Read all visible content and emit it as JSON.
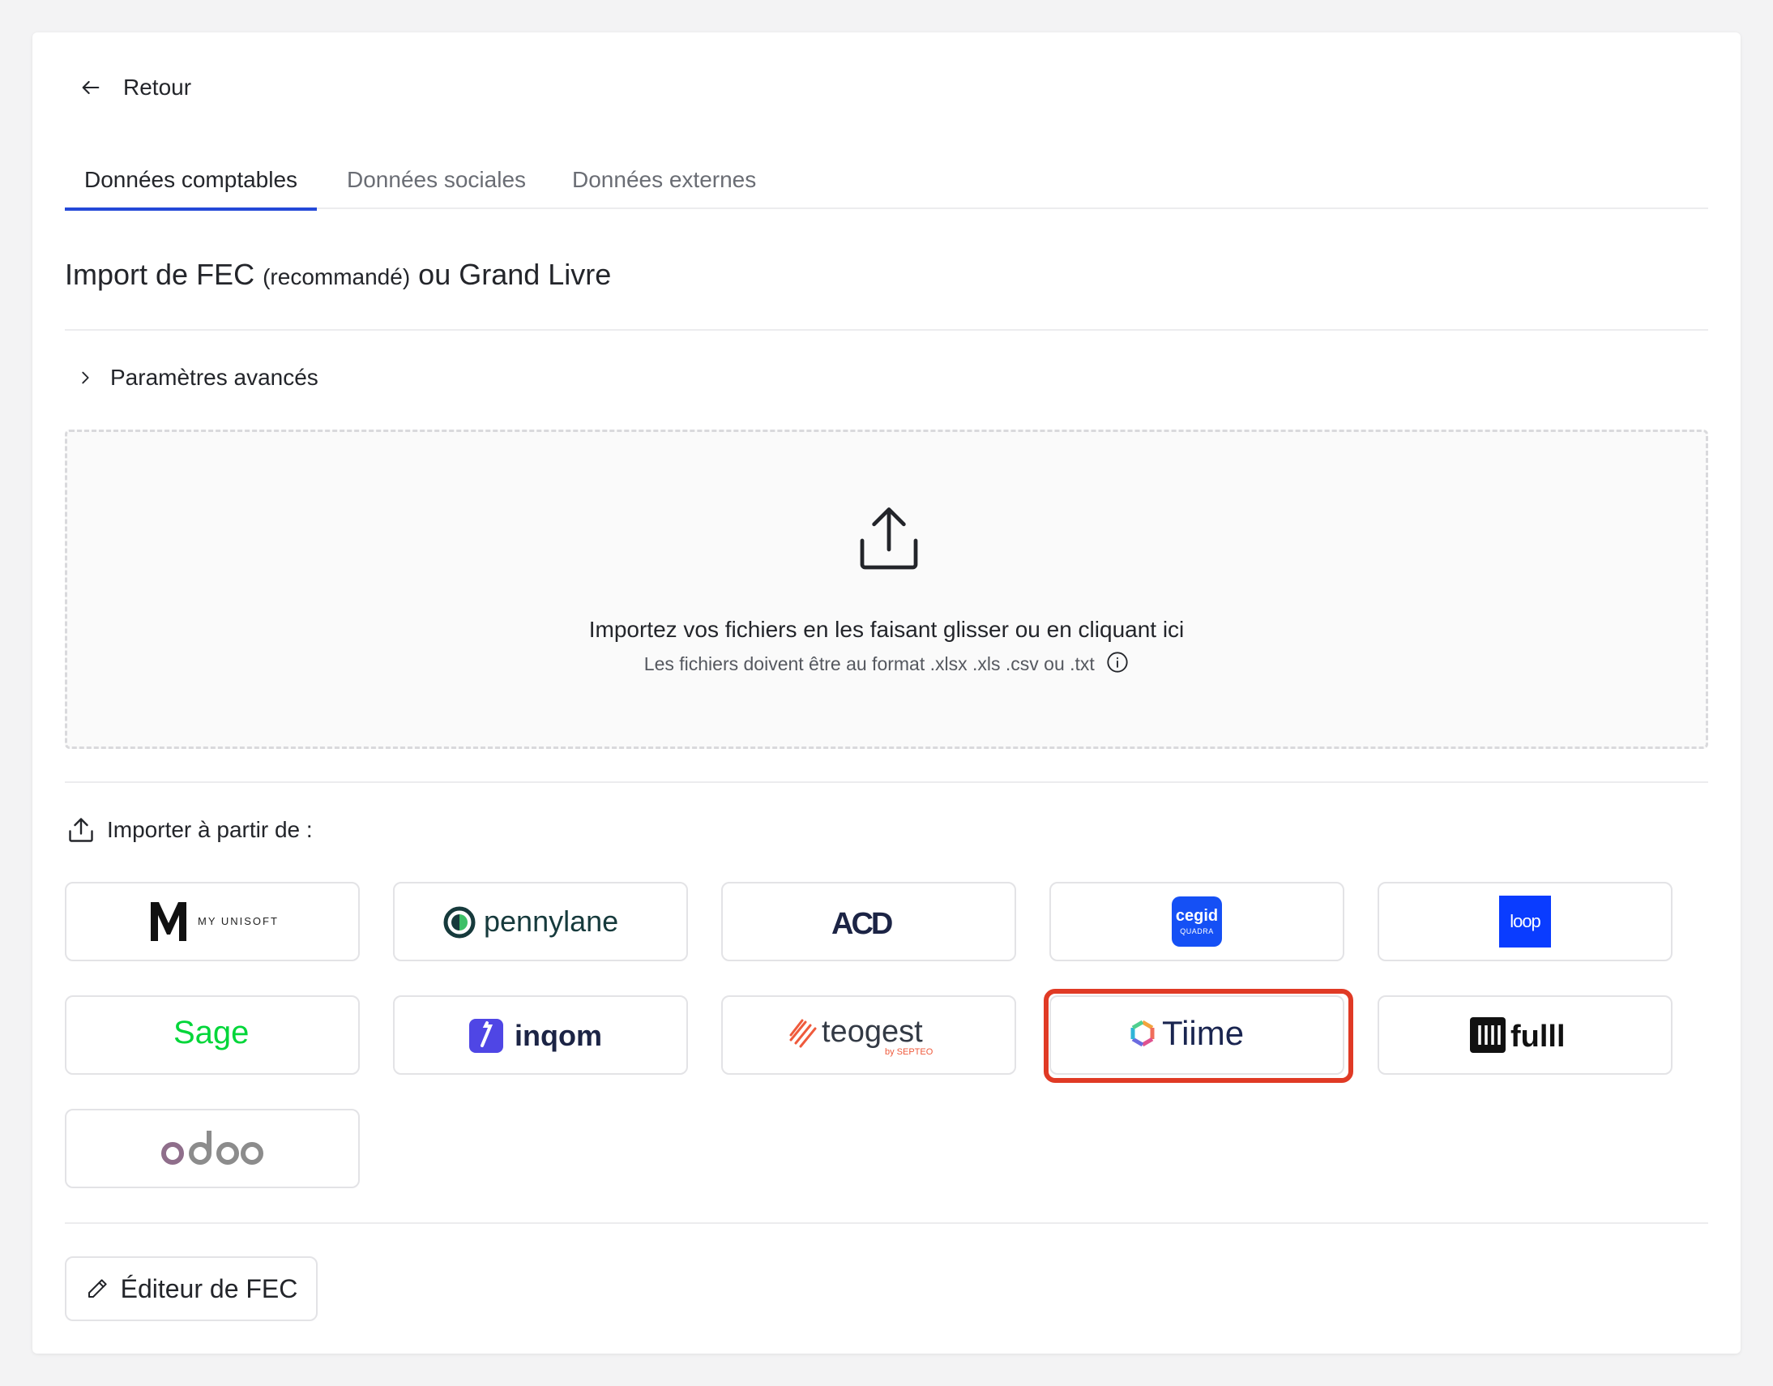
{
  "nav": {
    "back_label": "Retour"
  },
  "tabs": [
    {
      "label": "Données comptables",
      "active": true
    },
    {
      "label": "Données sociales",
      "active": false
    },
    {
      "label": "Données externes",
      "active": false
    }
  ],
  "section": {
    "title_main": "Import de FEC",
    "title_note": "(recommandé)",
    "title_end": "ou Grand Livre"
  },
  "advanced": {
    "label": "Paramètres avancés"
  },
  "dropzone": {
    "title": "Importez vos fichiers en les faisant glisser ou en cliquant ici",
    "subtitle": "Les fichiers doivent être au format .xlsx .xls .csv ou .txt",
    "icon": "upload-icon"
  },
  "import_from": {
    "label": "Importer à partir de :"
  },
  "integrations": [
    {
      "id": "myunisoft",
      "logo_text": "M",
      "sub_text": "MY UNISOFT"
    },
    {
      "id": "pennylane",
      "logo_text": "pennylane"
    },
    {
      "id": "acd",
      "logo_text": "ACD"
    },
    {
      "id": "cegid",
      "logo_text": "cegid",
      "sub_text": "QUADRA"
    },
    {
      "id": "loop",
      "logo_text": "loop"
    },
    {
      "id": "sage",
      "logo_text": "Sage"
    },
    {
      "id": "inqom",
      "logo_text": "inqom"
    },
    {
      "id": "teogest",
      "logo_text": "teogest",
      "sub_text": "by SEPTEO"
    },
    {
      "id": "tiime",
      "logo_text": "Tiime",
      "highlighted": true
    },
    {
      "id": "fulll",
      "logo_text": "fulll"
    },
    {
      "id": "odoo",
      "logo_text": "odoo"
    }
  ],
  "editor": {
    "label": "Éditeur de FEC"
  },
  "colors": {
    "accent": "#2449d8",
    "highlight": "#e03a25",
    "sage": "#00d639",
    "cegid": "#1550f5",
    "odoo": "#8f6e8b"
  }
}
